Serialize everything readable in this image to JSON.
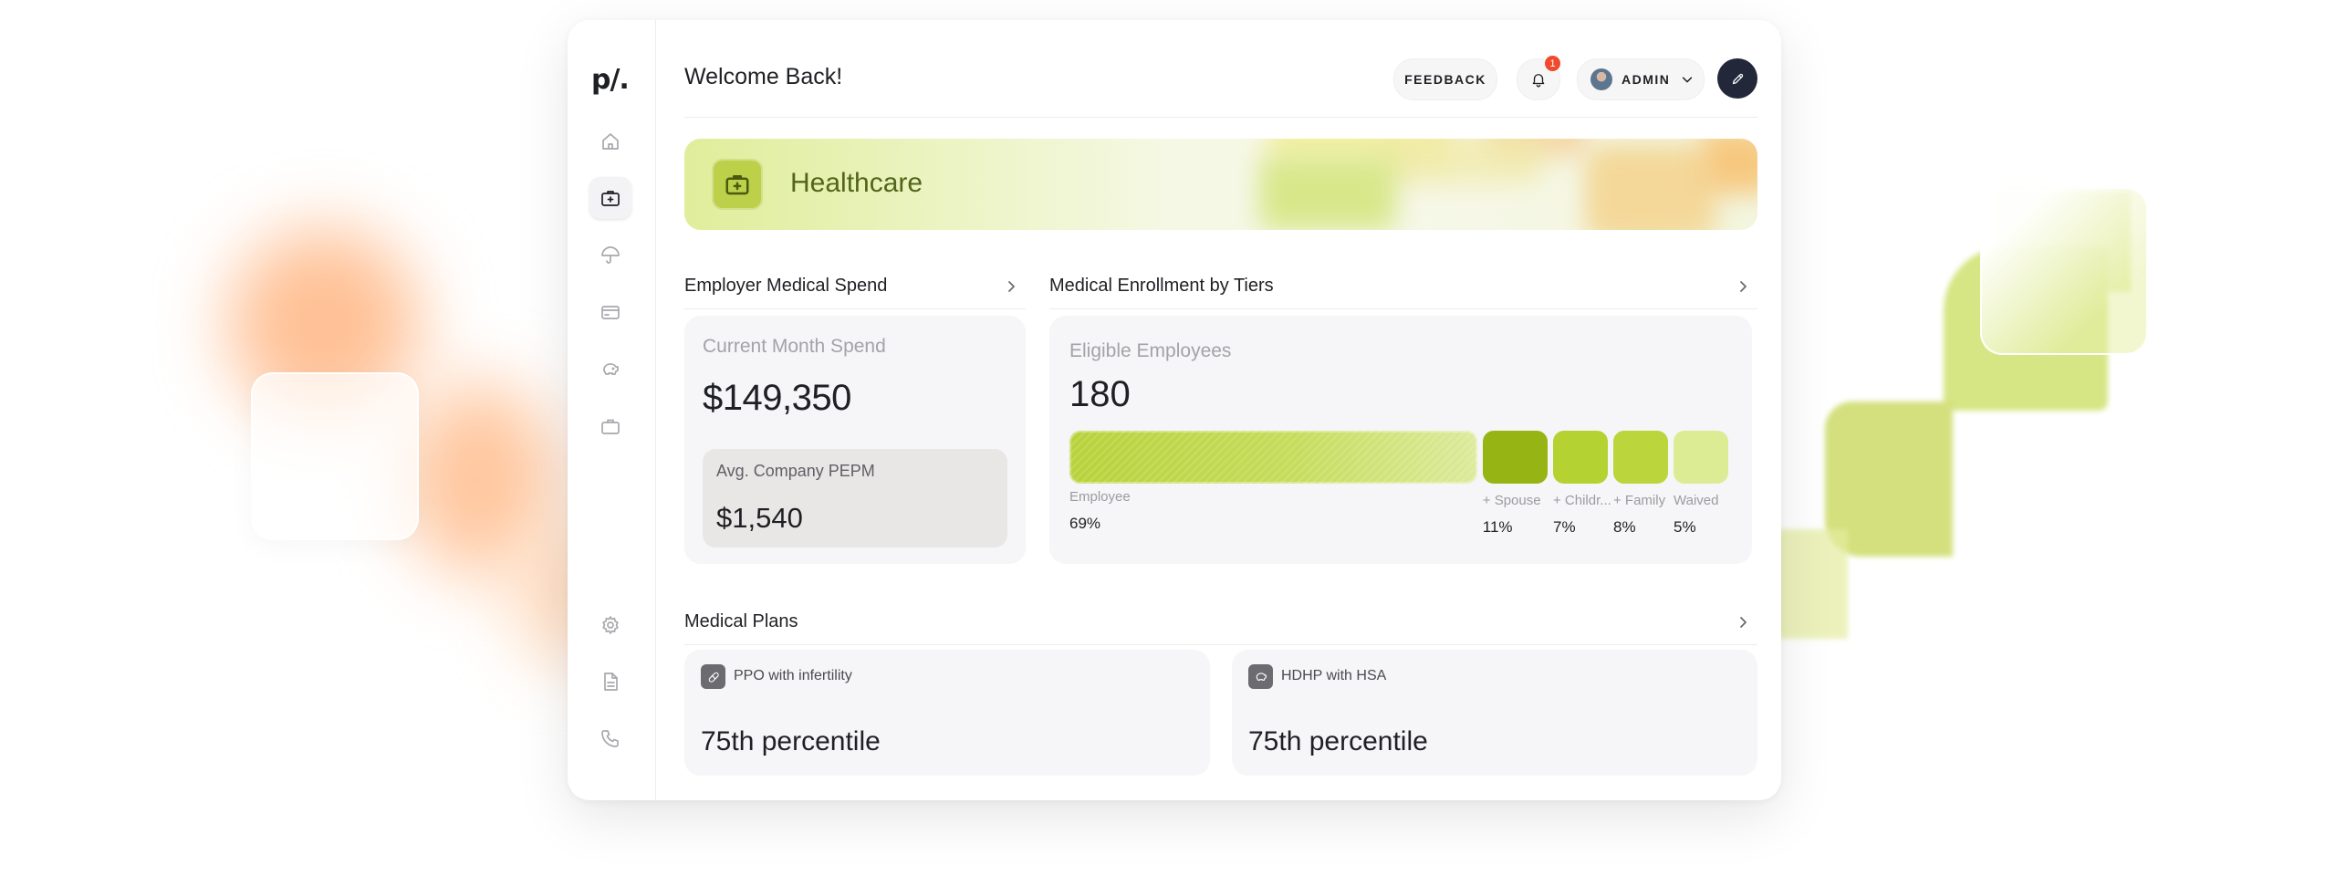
{
  "app": {
    "logo": "p/.",
    "welcome": "Welcome Back!"
  },
  "header": {
    "feedback_label": "FEEDBACK",
    "notification_count": "1",
    "user_label": "ADMIN"
  },
  "sidebar": {
    "items": [
      {
        "name": "home",
        "icon": "home-icon",
        "active": false
      },
      {
        "name": "healthcare",
        "icon": "medical-briefcase-icon",
        "active": true
      },
      {
        "name": "insurance",
        "icon": "umbrella-icon",
        "active": false
      },
      {
        "name": "cards",
        "icon": "credit-card-icon",
        "active": false
      },
      {
        "name": "savings",
        "icon": "piggy-bank-icon",
        "active": false
      },
      {
        "name": "work",
        "icon": "briefcase-icon",
        "active": false
      }
    ],
    "bottom_items": [
      {
        "name": "settings",
        "icon": "gear-icon"
      },
      {
        "name": "documents",
        "icon": "document-icon"
      },
      {
        "name": "support",
        "icon": "phone-icon"
      }
    ]
  },
  "banner": {
    "title": "Healthcare",
    "icon": "medical-briefcase-icon"
  },
  "spend": {
    "section_title": "Employer Medical Spend",
    "current_label": "Current Month Spend",
    "current_value": "$149,350",
    "pepm_label": "Avg. Company PEPM",
    "pepm_value": "$1,540"
  },
  "enrollment": {
    "section_title": "Medical Enrollment by Tiers",
    "eligible_label": "Eligible Employees",
    "eligible_value": "180",
    "tiers": [
      {
        "label": "Employee",
        "pct": "69%",
        "share": 0.69,
        "color": "#b9d440"
      },
      {
        "label": "+ Spouse",
        "pct": "11%",
        "share": 0.11,
        "color": "#96b514"
      },
      {
        "label": "+ Childr...",
        "pct": "7%",
        "share": 0.07,
        "color": "#b4d232"
      },
      {
        "label": "+ Family",
        "pct": "8%",
        "share": 0.08,
        "color": "#bbd63c"
      },
      {
        "label": "Waived",
        "pct": "5%",
        "share": 0.05,
        "color": "#dcec94"
      }
    ]
  },
  "plans": {
    "section_title": "Medical Plans",
    "items": [
      {
        "name": "PPO with infertility",
        "value": "75th percentile",
        "icon": "pill-icon"
      },
      {
        "name": "HDHP with HSA",
        "value": "75th percentile",
        "icon": "piggy-bank-icon"
      }
    ]
  },
  "colors": {
    "accent_green": "#bcd04a",
    "banner_text": "#52651a",
    "badge_red": "#f0492e",
    "dark_button": "#22283a"
  }
}
